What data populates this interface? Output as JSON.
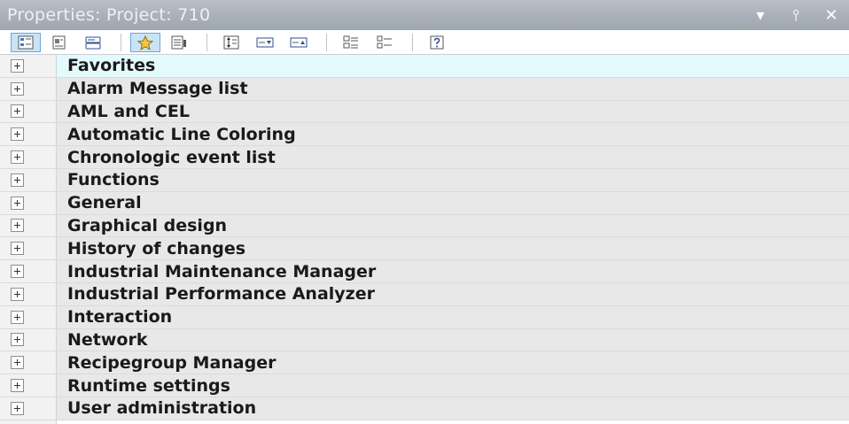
{
  "window": {
    "title": "Properties: Project: 710",
    "controls": [
      {
        "name": "dropdown-icon",
        "glyph": "▾"
      },
      {
        "name": "pin-icon",
        "glyph": "⫯"
      },
      {
        "name": "close-icon",
        "glyph": "✕"
      }
    ]
  },
  "toolbar": {
    "groups": [
      [
        "categorized-view-icon",
        "sheet-icon",
        "card-view-icon"
      ],
      [
        "favorites-star-icon",
        "properties-grid-icon"
      ],
      [
        "column-sort-icon",
        "expand-down-icon",
        "collapse-up-icon"
      ],
      [
        "detail-list-icon",
        "tree-list-icon"
      ],
      [
        "help-icon"
      ]
    ],
    "active": [
      "categorized-view-icon",
      "favorites-star-icon"
    ]
  },
  "categories": [
    "Favorites",
    "Alarm Message list",
    "AML and CEL",
    "Automatic Line Coloring",
    "Chronologic event list",
    "Functions",
    "General",
    "Graphical design",
    "History of changes",
    "Industrial Maintenance Manager",
    "Industrial Performance Analyzer",
    "Interaction",
    "Network",
    "Recipegroup Manager",
    "Runtime settings",
    "User administration"
  ],
  "selected_index": 0,
  "colors": {
    "title_bar": "#a9b0b8",
    "selected_row": "#e4fbfd",
    "row_bg": "#e8e8e8",
    "active_tool": "#c9e4f7"
  }
}
